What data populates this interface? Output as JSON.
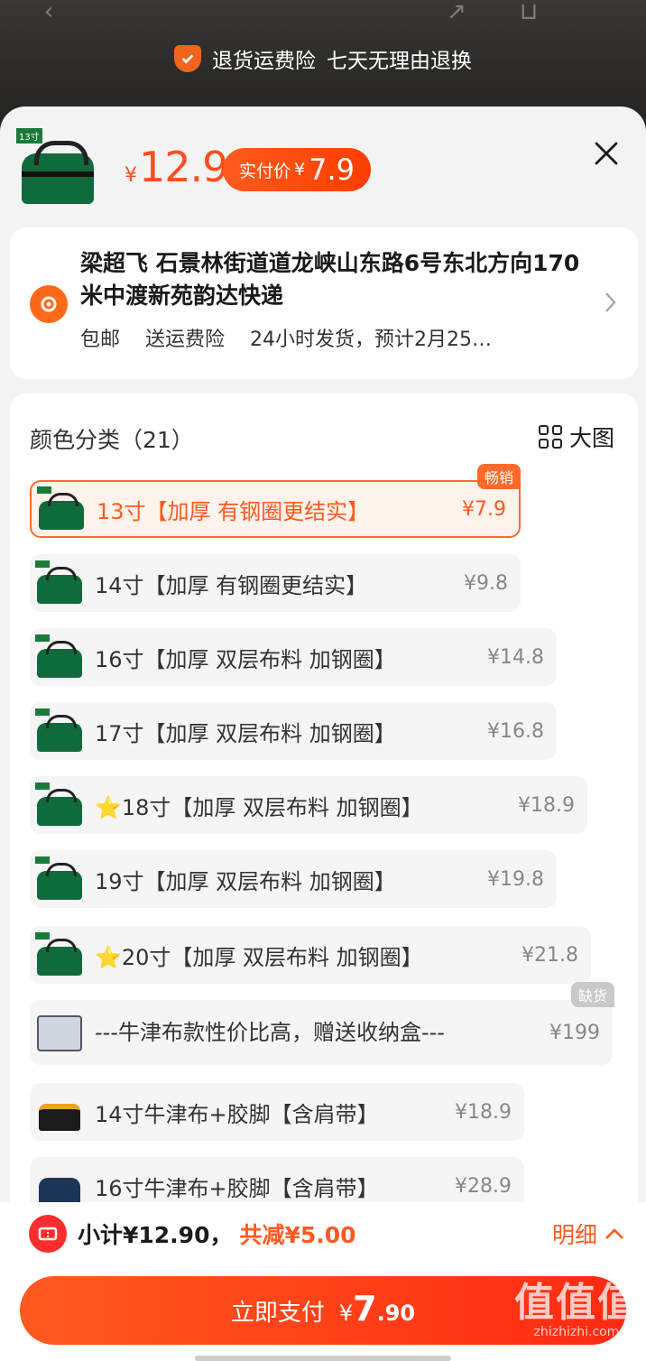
{
  "banner": {
    "insurance": "退货运费险",
    "returns": "七天无理由退换"
  },
  "product": {
    "thumb_tag": "13寸",
    "price_symbol": "¥",
    "price": "12.9",
    "real_price_label": "实付价",
    "real_price_symbol": "¥",
    "real_price": "7.9"
  },
  "address": {
    "text": "梁超飞  石景林街道道龙峡山东路6号东北方向170米中渡新苑韵达快递",
    "tags": [
      "包邮",
      "送运费险",
      "24小时发货，预计2月25…"
    ]
  },
  "sku_section": {
    "title": "颜色分类（21）",
    "big_pic_label": "大图",
    "items": [
      {
        "label": "13寸【加厚  有钢圈更结实】",
        "price": "¥7.9",
        "badge": "畅销",
        "selected": true,
        "thumb": "green-bag"
      },
      {
        "label": "14寸【加厚  有钢圈更结实】",
        "price": "¥9.8",
        "badge": "",
        "selected": false,
        "thumb": "green-bag"
      },
      {
        "label": "16寸【加厚  双层布料  加钢圈】",
        "price": "¥14.8",
        "badge": "",
        "selected": false,
        "thumb": "green-bag"
      },
      {
        "label": "17寸【加厚  双层布料  加钢圈】",
        "price": "¥16.8",
        "badge": "",
        "selected": false,
        "thumb": "green-bag"
      },
      {
        "label": "⭐18寸【加厚  双层布料  加钢圈】",
        "price": "¥18.9",
        "badge": "",
        "selected": false,
        "thumb": "green-bag"
      },
      {
        "label": "19寸【加厚  双层布料  加钢圈】",
        "price": "¥19.8",
        "badge": "",
        "selected": false,
        "thumb": "green-bag"
      },
      {
        "label": "⭐20寸【加厚  双层布料  加钢圈】",
        "price": "¥21.8",
        "badge": "",
        "selected": false,
        "thumb": "green-bag"
      },
      {
        "label": "---牛津布款性价比高，赠送收纳盒---",
        "price": "¥199",
        "badge": "缺货",
        "selected": false,
        "thumb": "storage-box"
      },
      {
        "label": "14寸牛津布+胶脚【含肩带】",
        "price": "¥18.9",
        "badge": "",
        "selected": false,
        "thumb": "yellow-bag"
      },
      {
        "label": "16寸牛津布+胶脚【含肩带】",
        "price": "¥28.9",
        "badge": "",
        "selected": false,
        "thumb": "blue-bag"
      }
    ]
  },
  "footer": {
    "subtotal": "小计¥12.90，",
    "reduction": "共减¥5.00",
    "detail_label": "明细",
    "pay_label": "立即支付",
    "pay_symbol": "¥",
    "pay_amount": "7",
    "pay_decimal": ".90"
  },
  "watermark": {
    "logo_text": "值值值",
    "site": "zhizhizhi.com"
  },
  "colors": {
    "accent": "#ff5a1f",
    "selected_border": "#ff6a2a",
    "sold_out_badge": "#c9c9c9"
  }
}
